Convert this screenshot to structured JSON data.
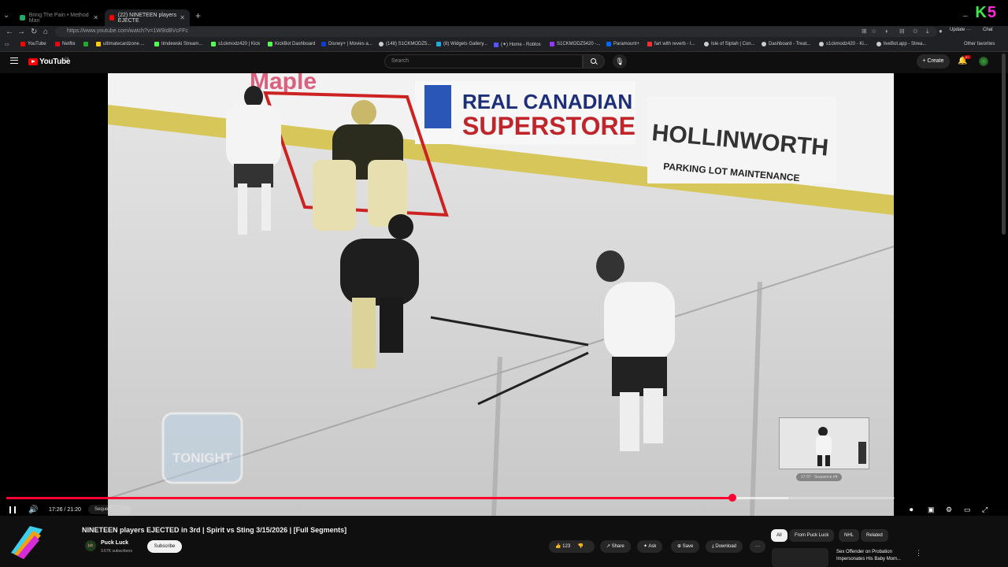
{
  "browser": {
    "tabs": [
      {
        "label": "Bring The Pain • Method Man"
      },
      {
        "label": "(22) NINETEEN players EJECTE"
      }
    ],
    "url": "https://www.youtube.com/watch?v=1W9Id8VcFFc",
    "update_label": "Update",
    "chat_label": "Chat",
    "brand_k": "K",
    "brand_5": "5",
    "bookmarks": [
      "YouTube",
      "Netflix",
      "ultimatecardzone ...",
      "timdewski Stream...",
      "s1ckmodz420 | Kick",
      "KickBot Dashboard",
      "Disney+ | Movies a...",
      "(148) S1CKMODZ5...",
      "(8) Widgets Gallery...",
      "(✦) Home - Roblox",
      "S1CKMODZ5420 -...",
      "Paramount+",
      "fart with reverb - I...",
      "Isle of Siptah | Con...",
      "Dashboard - Treat...",
      "s1ckmodz420 - Ki...",
      "liveBot.app - Strea..."
    ],
    "other_favorites": "Other favorites"
  },
  "youtube": {
    "logo_text": "YouTube",
    "country_code": "CA",
    "search_placeholder": "Search",
    "create_label": "Create",
    "notif_badge": "9+"
  },
  "player": {
    "current_time": "17:26",
    "duration": "21:20",
    "time_display": "17:26 / 21:20",
    "chapter_label": "Sequence #4 ›",
    "progress_fraction": 0.817,
    "buffered_fraction": 0.88,
    "preview_label": "17:37 · Sequence #4",
    "watermark": "TONIGHT",
    "colors": {
      "progress": "#ff0033"
    }
  },
  "video": {
    "title": "NINETEEN players EJECTED in 3rd | Spirit vs Sting 3/15/2026 | [Full Segments]",
    "channel": "Puck Luck",
    "subscribers": "3.67K subscribers",
    "subscribe_label": "Subscribe",
    "like_count": "123",
    "share_label": "Share",
    "ask_label": "Ask",
    "save_label": "Save",
    "download_label": "Download"
  },
  "sidebar": {
    "filters": [
      "All",
      "From Puck Luck",
      "NHL",
      "Related"
    ],
    "rec_title": "Sex Offender on Probation Impersonates His Baby Mom..."
  },
  "arena_signs": {
    "sign1": "REAL CANADIAN",
    "sign2": "SUPERSTORE",
    "sign3": "HOLLINWORTH",
    "sign4": "PARKING LOT MAINTENANCE",
    "sign5": "Maple"
  }
}
